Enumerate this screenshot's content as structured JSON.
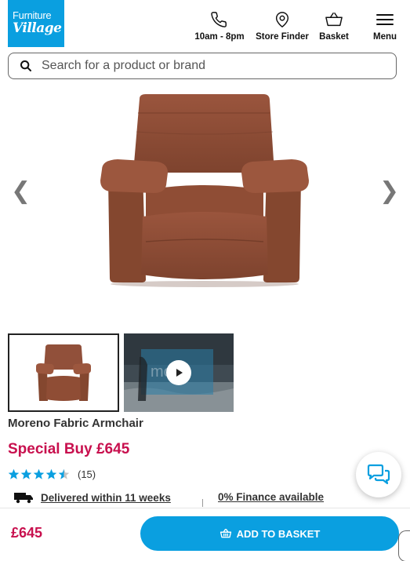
{
  "header": {
    "logo": {
      "line1": "Furniture",
      "line2": "Village"
    },
    "nav": {
      "hours": {
        "label": "10am - 8pm",
        "icon": "phone-icon"
      },
      "store": {
        "label": "Store Finder",
        "icon": "map-pin-icon"
      },
      "basket": {
        "label": "Basket",
        "icon": "basket-icon"
      },
      "menu": {
        "label": "Menu",
        "icon": "hamburger-menu-icon"
      }
    }
  },
  "search": {
    "placeholder": "Search for a product or brand",
    "value": ""
  },
  "gallery": {
    "prev_arrow": "❮",
    "next_arrow": "❯",
    "video_watermark": "mo"
  },
  "product": {
    "title": "Moreno Fabric Armchair",
    "price_line": "Special Buy £645",
    "rating_stars": 4.5,
    "review_count": "(15)",
    "delivery": "Delivered within 11 weeks",
    "finance": "0% Finance available"
  },
  "bottom": {
    "price": "£645",
    "add_label": "ADD TO BASKET"
  },
  "colors": {
    "brand_blue": "#0a9fe0",
    "price_red": "#c8104e",
    "chair_brown": "#8b4a34"
  }
}
